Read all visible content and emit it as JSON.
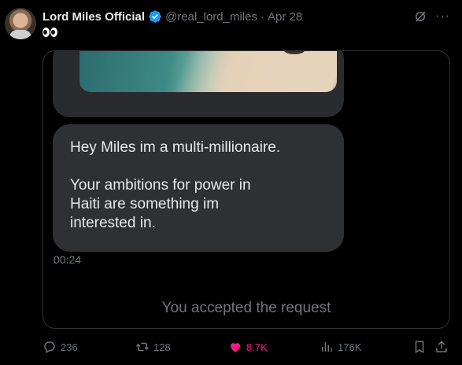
{
  "post": {
    "author_name": "Lord Miles Official",
    "handle": "@real_lord_miles",
    "separator": "·",
    "date": "Apr 28"
  },
  "media": {
    "message_text": "Hey Miles im a multi-millionaire.\n\nYour ambitions for power in\nHaiti are something im\ninterested in.",
    "timestamp": "00:24",
    "status_text": "You accepted the request"
  },
  "actions": {
    "replies": "236",
    "reposts": "128",
    "likes": "8.7K",
    "views": "176K"
  },
  "colors": {
    "verified_blue": "#1d9bf0",
    "like_pink": "#f91880",
    "muted_gray": "#71767b"
  },
  "icons": [
    "grok-icon",
    "more-icon",
    "reply-icon",
    "repost-icon",
    "heart-icon",
    "views-icon",
    "bookmark-icon",
    "share-icon"
  ]
}
